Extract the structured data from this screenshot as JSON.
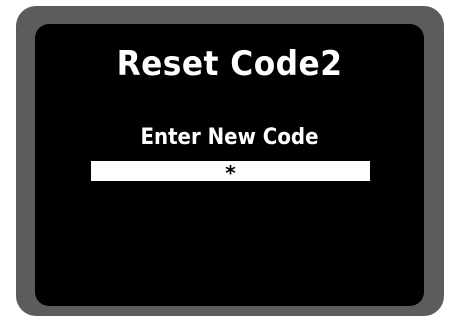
{
  "screen": {
    "title": "Reset Code2",
    "prompt": "Enter New Code",
    "code_value": "*"
  },
  "colors": {
    "bezel": "#5c5c5c",
    "screen_bg": "#000000",
    "text": "#ffffff",
    "field_bg": "#ffffff",
    "field_text": "#000000"
  }
}
